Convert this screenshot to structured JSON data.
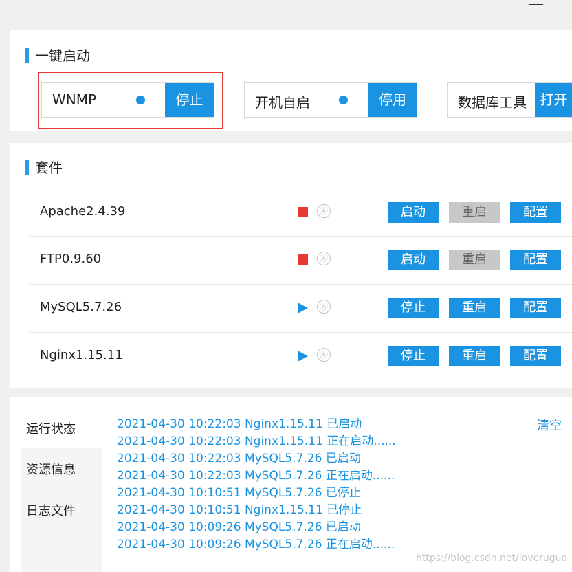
{
  "quick_start": {
    "title": "一键启动",
    "groups": [
      {
        "label": "WNMP",
        "button": "停止"
      },
      {
        "label": "开机自启",
        "button": "停用"
      },
      {
        "label": "数据库工具",
        "button": "打开"
      }
    ]
  },
  "suite": {
    "title": "套件",
    "services": [
      {
        "name": "Apache2.4.39",
        "status": "stopped",
        "auto_icon": "Ⓐ",
        "buttons": [
          "启动",
          "重启",
          "配置"
        ]
      },
      {
        "name": "FTP0.9.60",
        "status": "stopped",
        "auto_icon": "Ⓐ",
        "buttons": [
          "启动",
          "重启",
          "配置"
        ]
      },
      {
        "name": "MySQL5.7.26",
        "status": "running",
        "auto_icon": "Ⓐ",
        "buttons": [
          "停止",
          "重启",
          "配置"
        ]
      },
      {
        "name": "Nginx1.15.11",
        "status": "running",
        "auto_icon": "Ⓐ",
        "buttons": [
          "停止",
          "重启",
          "配置"
        ]
      }
    ]
  },
  "log": {
    "tabs": [
      "运行状态",
      "资源信息",
      "日志文件"
    ],
    "clear": "清空",
    "lines": [
      "2021-04-30 10:22:03 Nginx1.15.11 已启动",
      "2021-04-30 10:22:03 Nginx1.15.11 正在启动......",
      "2021-04-30 10:22:03 MySQL5.7.26 已启动",
      "2021-04-30 10:22:03 MySQL5.7.26 正在启动......",
      "2021-04-30 10:10:51 MySQL5.7.26 已停止",
      "2021-04-30 10:10:51 Nginx1.15.11 已停止",
      "2021-04-30 10:09:26 MySQL5.7.26 已启动",
      "2021-04-30 10:09:26 MySQL5.7.26 正在启动......"
    ]
  },
  "watermark": "https://blog.csdn.net/loveruguo",
  "colors": {
    "accent": "#1a93e2",
    "stopped": "#e53935",
    "disabled_button": "#c8c8c8"
  }
}
